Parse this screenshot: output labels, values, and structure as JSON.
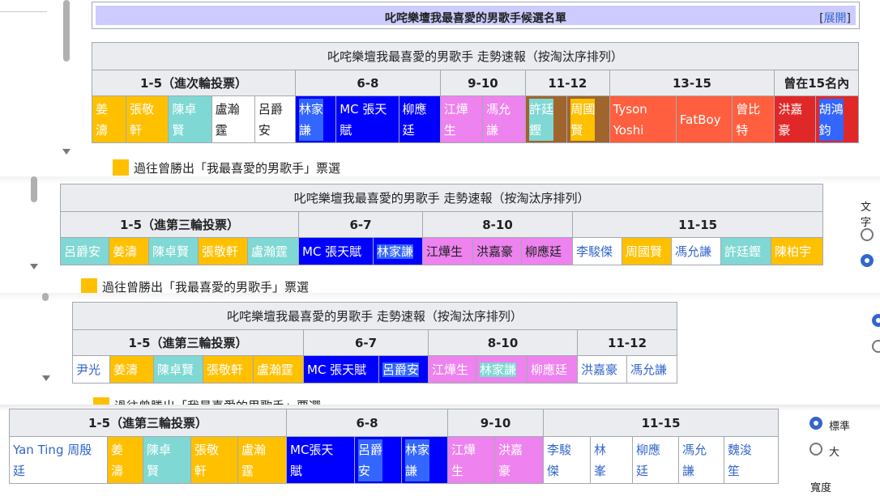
{
  "nav": {
    "title": "叱咤樂壇我最喜愛的男歌手候選名單",
    "expand_open": "[",
    "expand": "展開",
    "expand_close": "]"
  },
  "table_title": "叱咤樂壇我最喜愛的男歌手 走勢速報（按淘汰序排列）",
  "legend": "過往曾勝出「我最喜愛的男歌手」票選",
  "t1": {
    "h": [
      "1-5（進次輪投票）",
      "6-8",
      "9-10",
      "11-12",
      "13-15",
      "曾在15名內"
    ],
    "c": [
      "姜\n濤",
      "張敬\n軒",
      "陳卓\n賢",
      "盧瀚\n霆",
      "呂爵\n安",
      "林家\n謙",
      "MC 張天\n賦",
      "柳應\n廷",
      "江燁\n生",
      "馮允\n謙",
      "許廷\n鏗",
      "周國\n賢",
      "Tyson\nYoshi",
      "FatBoy",
      "曾比\n特",
      "洪嘉\n豪",
      "胡鴻\n鈞"
    ]
  },
  "t2": {
    "h": [
      "1-5（進第三輪投票）",
      "6-7",
      "8-10",
      "11-15"
    ],
    "c": [
      "呂爵安",
      "姜濤",
      "陳卓賢",
      "張敬軒",
      "盧瀚霆",
      "MC 張天賦",
      "林家謙",
      "江燁生",
      "洪嘉豪",
      "柳應廷",
      "李駿傑",
      "周國賢",
      "馮允謙",
      "許廷鏗",
      "陳柏宇"
    ]
  },
  "t3": {
    "h": [
      "1-5（進第三輪投票）",
      "6-7",
      "8-10",
      "11-12"
    ],
    "c": [
      "尹光",
      "姜濤",
      "陳卓賢",
      "張敬軒",
      "盧瀚霆",
      "MC 張天賦",
      "呂爵安",
      "江燁生",
      "林家謙",
      "柳應廷",
      "洪嘉豪",
      "馮允謙"
    ]
  },
  "t4": {
    "h": [
      "1-5（進第三輪投票）",
      "6-8",
      "9-10",
      "11-15"
    ],
    "c": [
      "Yan Ting 周殷\n廷",
      "姜\n濤",
      "陳卓\n賢",
      "張敬\n軒",
      "盧瀚\n霆",
      "MC張天\n賦",
      "呂爵\n安",
      "林家\n謙",
      "江燁\n生",
      "洪嘉\n豪",
      "李駿\n傑",
      "林\n峯",
      "柳應\n廷",
      "馮允\n謙",
      "魏浚\n笙"
    ]
  },
  "side": {
    "text_label": "文字",
    "standard": "標準",
    "large": "大",
    "width_label": "寬度"
  }
}
